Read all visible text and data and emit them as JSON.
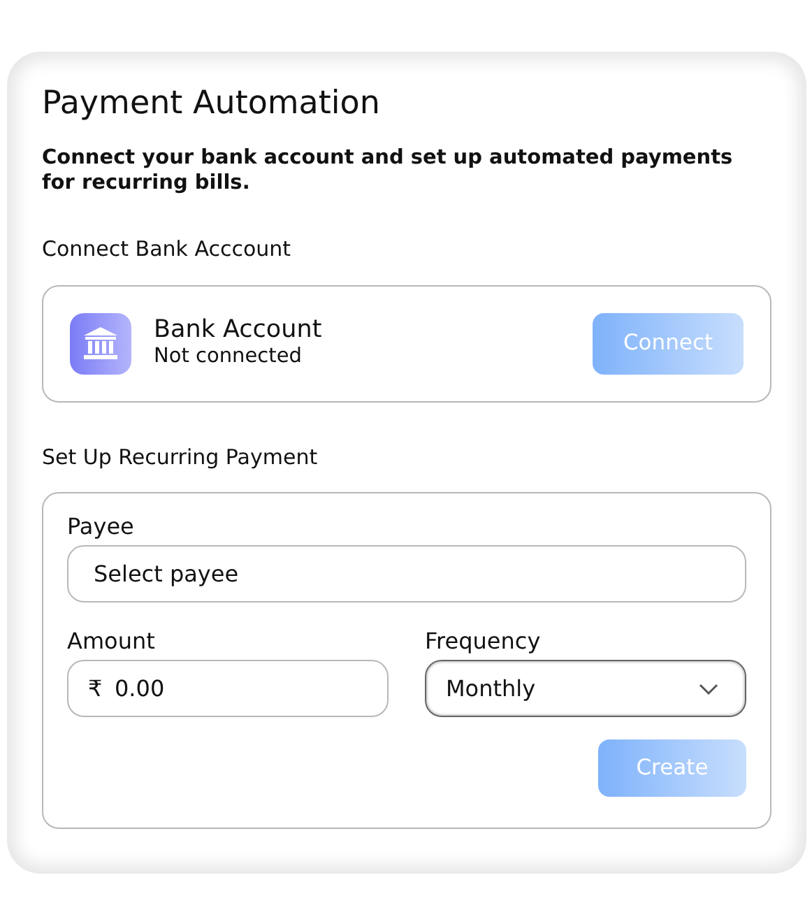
{
  "title": "Payment Automation",
  "description": "Connect your bank account and set up automated payments for recurring bills.",
  "bank_section": {
    "heading": "Connect Bank Acccount",
    "account_name": "Bank Account",
    "status": "Not connected",
    "button": {
      "label": "Connect",
      "disabled": true
    }
  },
  "payment_section": {
    "heading": "Set Up Recurring Payment",
    "payee": {
      "label": "Payee",
      "placeholder": "Select payee"
    },
    "amount": {
      "label": "Amount",
      "currency": "₹",
      "value": "0.00"
    },
    "frequency": {
      "label": "Frequency",
      "value": "Monthly"
    },
    "button": {
      "label": "Create",
      "disabled": true
    }
  }
}
